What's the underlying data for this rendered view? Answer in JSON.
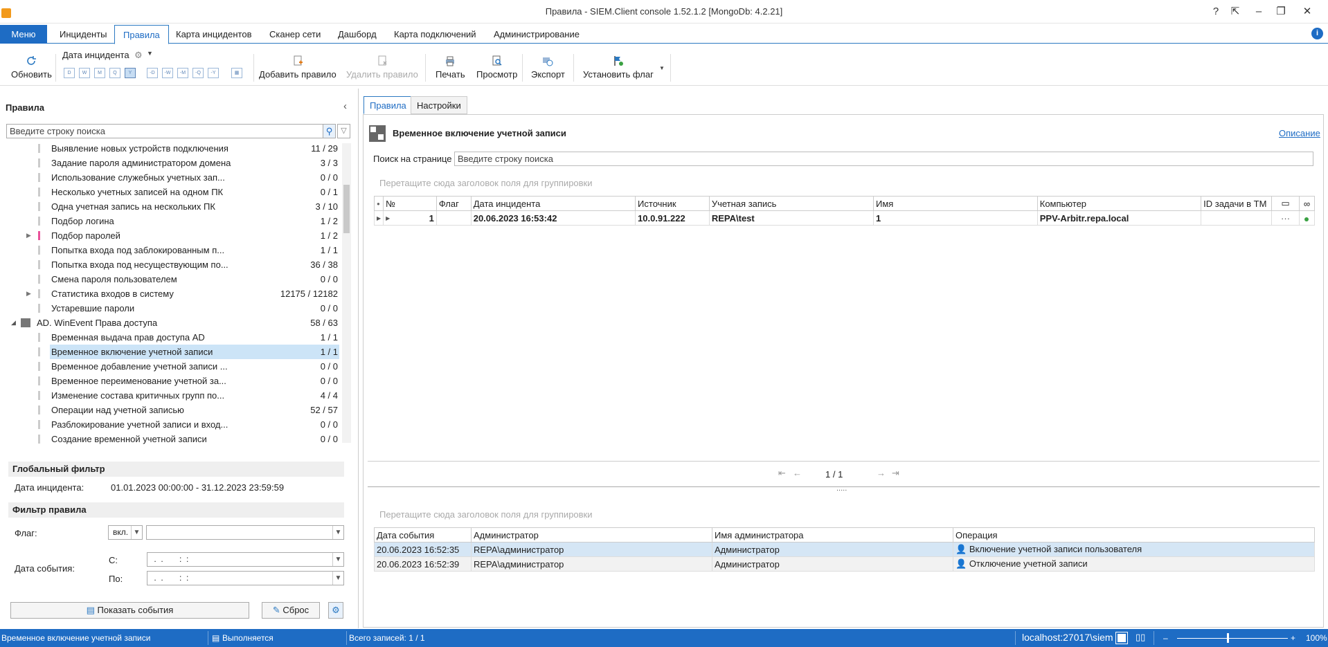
{
  "window": {
    "title": "Правила - SIEM.Client console 1.52.1.2 [MongoDb: 4.2.21]",
    "help_icon": "?",
    "btn_restore_label": "⇱",
    "btn_minimize": "–",
    "btn_maximize": "❐",
    "btn_close": "✕"
  },
  "menubar": {
    "menu": "Меню",
    "tabs": [
      "Инциденты",
      "Правила",
      "Карта инцидентов",
      "Сканер сети",
      "Дашборд",
      "Карта подключений",
      "Администрирование"
    ],
    "active_tab": "Правила"
  },
  "ribbon": {
    "refresh": "Обновить",
    "incident_date": "Дата инцидента",
    "period_left": [
      "D",
      "W",
      "M",
      "Q",
      "Y"
    ],
    "period_right": [
      "-D",
      "-W",
      "-M",
      "-Q",
      "-Y"
    ],
    "add_rule": "Добавить правило",
    "delete_rule": "Удалить правило",
    "print": "Печать",
    "preview": "Просмотр",
    "export": "Экспорт",
    "set_flag": "Установить флаг"
  },
  "left": {
    "title": "Правила",
    "search_placeholder": "Введите строку поиска",
    "rules": [
      {
        "label": "Выявление новых устройств подключения",
        "count": "11 / 29"
      },
      {
        "label": "Задание пароля администратором домена",
        "count": "3 / 3"
      },
      {
        "label": "Использование служебных учетных зап...",
        "count": "0 / 0"
      },
      {
        "label": "Несколько учетных записей на одном ПК",
        "count": "0 / 1"
      },
      {
        "label": "Одна учетная запись на нескольких ПК",
        "count": "3 / 10"
      },
      {
        "label": "Подбор логина",
        "count": "1 / 2"
      },
      {
        "label": "Подбор паролей",
        "count": "1 / 2"
      },
      {
        "label": "Попытка входа под заблокированным п...",
        "count": "1 / 1"
      },
      {
        "label": "Попытка входа под несуществующим по...",
        "count": "36 / 38"
      },
      {
        "label": "Смена пароля пользователем",
        "count": "0 / 0"
      },
      {
        "label": "Статистика входов в систему",
        "count": "12175 / 12182"
      },
      {
        "label": "Устаревшие пароли",
        "count": "0 / 0"
      },
      {
        "label": "AD. WinEvent Права доступа",
        "count": "58 / 63"
      },
      {
        "label": "Временная выдача прав доступа AD",
        "count": "1 / 1"
      },
      {
        "label": "Временное включение учетной записи",
        "count": "1 / 1"
      },
      {
        "label": "Временное добавление учетной записи ...",
        "count": "0 / 0"
      },
      {
        "label": "Временное переименование учетной за...",
        "count": "0 / 0"
      },
      {
        "label": "Изменение состава критичных групп по...",
        "count": "4 / 4"
      },
      {
        "label": "Операции над учетной записью",
        "count": "52 / 57"
      },
      {
        "label": "Разблокирование учетной записи и вход...",
        "count": "0 / 0"
      },
      {
        "label": "Создание временной учетной записи",
        "count": "0 / 0"
      }
    ],
    "global_filter": {
      "title": "Глобальный фильтр",
      "date_label": "Дата инцидента:",
      "date_value": "01.01.2023 00:00:00 - 31.12.2023 23:59:59"
    },
    "rule_filter": {
      "title": "Фильтр правила",
      "flag_label": "Флаг:",
      "flag_mode": "вкл.",
      "event_date_label": "Дата события:",
      "from_label": "С:",
      "to_label": "По:",
      "date_mask": " .  .       :  :"
    },
    "show_events": "Показать события",
    "reset": "Сброс"
  },
  "right": {
    "tabs": [
      "Правила",
      "Настройки"
    ],
    "rule_title": "Временное включение учетной записи",
    "description_link": "Описание",
    "page_search_label": "Поиск на странице",
    "page_search_placeholder": "Введите строку поиска",
    "group_hint": "Перетащите сюда заголовок поля для группировки",
    "incidents": {
      "columns": [
        "№",
        "Флаг",
        "Дата инцидента",
        "Источник",
        "Учетная запись",
        "Имя",
        "Компьютер",
        "ID задачи в ТМ"
      ],
      "rows": [
        {
          "num": "1",
          "flag": "",
          "date": "20.06.2023 16:53:42",
          "source": "10.0.91.222",
          "account": "REPA\\test",
          "name": "1",
          "computer": "PPV-Arbitr.repa.local",
          "tm": "",
          "more": "···"
        }
      ]
    },
    "pager": "1 / 1",
    "splitter": ".....",
    "events": {
      "columns": [
        "Дата события",
        "Администратор",
        "Имя администратора",
        "Операция"
      ],
      "rows": [
        {
          "date": "20.06.2023 16:52:35",
          "admin": "REPA\\администратор",
          "admin_name": "Администратор",
          "op": "Включение учетной записи пользователя"
        },
        {
          "date": "20.06.2023 16:52:39",
          "admin": "REPA\\администратор",
          "admin_name": "Администратор",
          "op": "Отключение учетной записи"
        }
      ]
    }
  },
  "status": {
    "rule": "Временное включение учетной записи",
    "state": "Выполняется",
    "records": "Всего записей: 1 / 1",
    "server": "localhost:27017\\siem",
    "zoom": "100%"
  },
  "colors": {
    "accent": "#1e6cc4",
    "selection": "#cce4f7",
    "event_row": "#d5e6f5"
  }
}
